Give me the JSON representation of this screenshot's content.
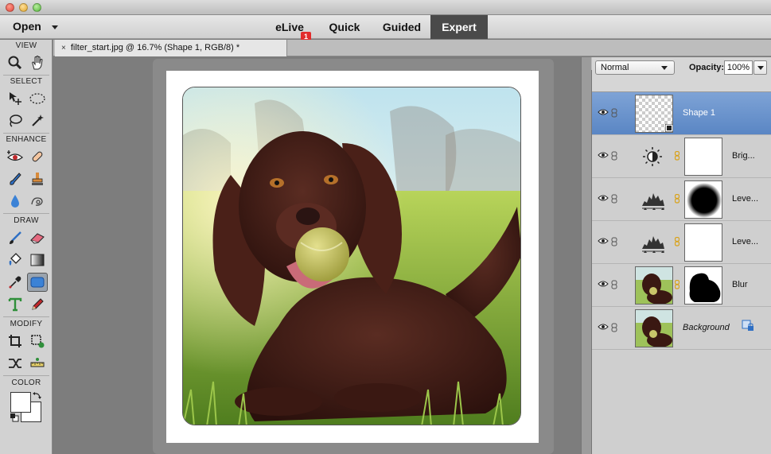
{
  "menubar": {
    "open_label": "Open",
    "modes": [
      {
        "label": "eLive"
      },
      {
        "label": "Quick"
      },
      {
        "label": "Guided"
      },
      {
        "label": "Expert"
      }
    ],
    "elive_badge": "1",
    "active_mode": "Expert"
  },
  "toolbox": {
    "sections": {
      "view": "VIEW",
      "select": "SELECT",
      "enhance": "ENHANCE",
      "draw": "DRAW",
      "modify": "MODIFY",
      "color": "COLOR"
    },
    "active_tool": "custom-shape-tool",
    "foreground_color": "#ffffff",
    "background_color": "#ffffff"
  },
  "document": {
    "tab_close": "×",
    "tab_title": "filter_start.jpg @ 16.7% (Shape 1, RGB/8) *"
  },
  "layers": {
    "blend_mode": "Normal",
    "opacity_label": "Opacity:",
    "opacity_value": "100%",
    "items": [
      {
        "name": "Shape 1",
        "selected": true
      },
      {
        "name": "Brig..."
      },
      {
        "name": "Leve..."
      },
      {
        "name": "Leve..."
      },
      {
        "name": "Blur"
      },
      {
        "name": "Background"
      }
    ]
  },
  "colors": {
    "selected_layer": "#5a86c4",
    "badge": "#e22c2c",
    "expert_tab": "#4a4a4a"
  }
}
